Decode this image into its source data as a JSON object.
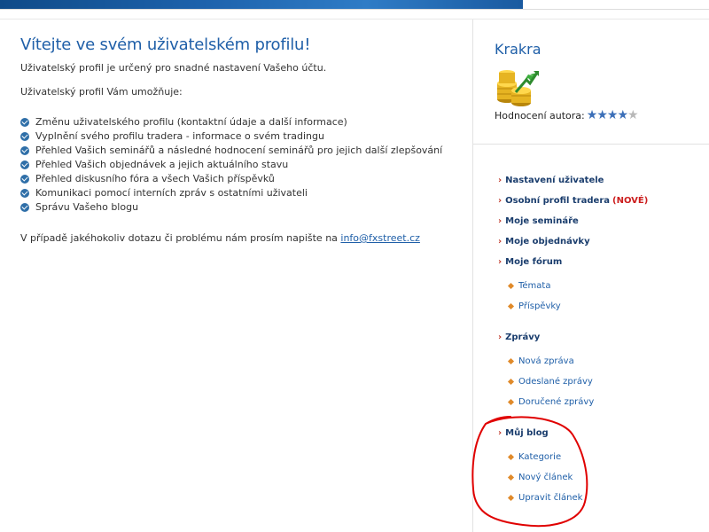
{
  "main": {
    "title": "Vítejte ve svém uživatelském profilu!",
    "intro": "Uživatelský profil je určený pro snadné nastavení Vašeho účtu.",
    "capabilities_heading": "Uživatelský profil Vám umožňuje:",
    "capabilities": [
      "Změnu uživatelského profilu (kontaktní údaje a další informace)",
      "Vyplnění svého profilu tradera - informace o svém tradingu",
      "Přehled Vašich seminářů a následné hodnocení seminářů pro jejich další zlepšování",
      "Přehled Vašich objednávek a jejich aktuálního stavu",
      "Přehled diskusního fóra a všech Vašich příspěvků",
      "Komunikaci pomocí interních zpráv s ostatními uživateli",
      "Správu Vašeho blogu"
    ],
    "contact_text": "V případě jakéhokoliv dotazu či problému nám prosím napište na",
    "contact_email": "info@fxstreet.cz"
  },
  "sidebar": {
    "author_name": "Krakra",
    "rating_label": "Hodnocení autora:",
    "rating": 4,
    "rating_max": 5,
    "nav": {
      "user_settings": "Nastavení uživatele",
      "trader_profile": "Osobní profil tradera",
      "trader_profile_badge": "(NOVÉ)",
      "seminars": "Moje semináře",
      "orders": "Moje objednávky",
      "forum": "Moje fórum",
      "forum_topics": "Témata",
      "forum_posts": "Příspěvky",
      "messages": "Zprávy",
      "messages_new": "Nová zpráva",
      "messages_sent": "Odeslané zprávy",
      "messages_received": "Doručené zprávy",
      "blog": "Můj blog",
      "blog_categories": "Kategorie",
      "blog_new_article": "Nový článek",
      "blog_edit_article": "Upravit článek"
    }
  },
  "colors": {
    "accent_blue": "#1f5fa8",
    "nav_text": "#1a3d6d",
    "new_badge": "#cc1e1e",
    "bullet_orange": "#e08a2a",
    "annotation_red": "#e00000"
  }
}
